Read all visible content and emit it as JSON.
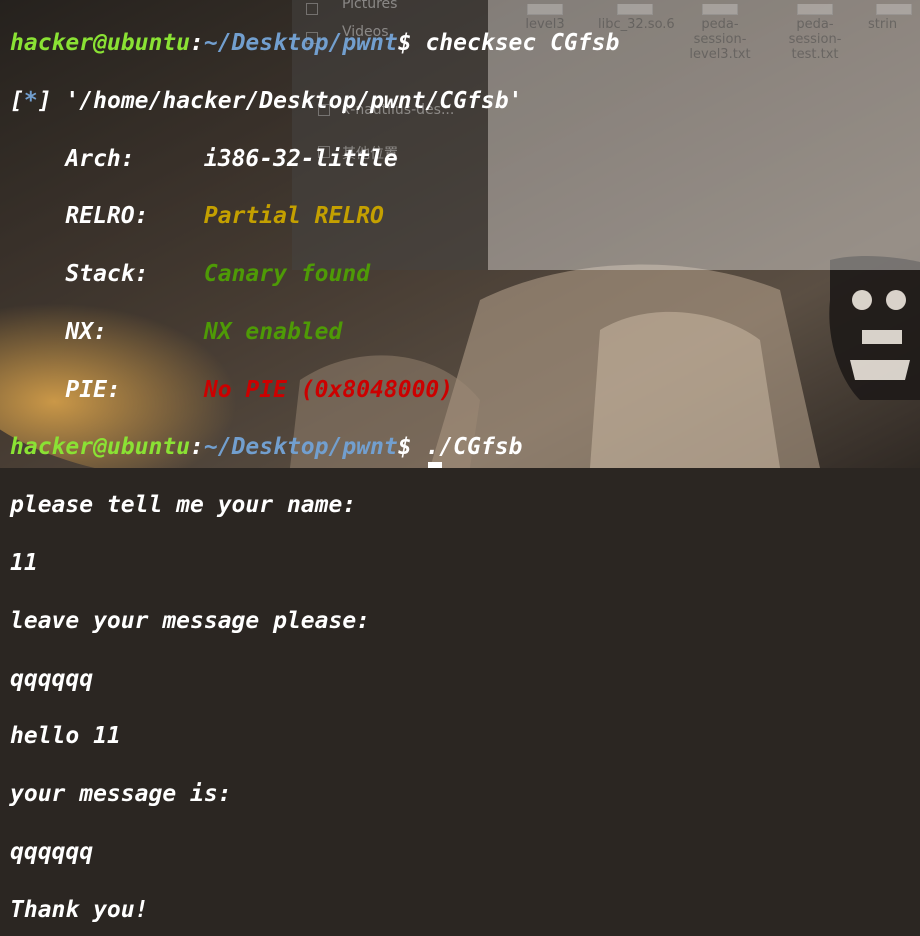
{
  "file_manager": {
    "sidebar": [
      "Pictures",
      "Videos",
      "x-nautilus-des...",
      "其他位置"
    ],
    "files": [
      "level3",
      "libc_32.so.6",
      "peda-session-level3.txt",
      "peda-session-test.txt",
      "strin"
    ]
  },
  "terminal": {
    "prompt1": {
      "user": "hacker@ubuntu",
      "colon": ":",
      "path": "~/Desktop/pwnt",
      "dollar": "$ ",
      "command": "checksec CGfsb"
    },
    "checksec": {
      "bracket_open": "[",
      "star": "*",
      "bracket_close": "]",
      "file": " '/home/hacker/Desktop/pwnt/CGfsb'",
      "arch_label": "    Arch:     ",
      "arch_value": "i386-32-little",
      "relro_label": "    RELRO:    ",
      "relro_value": "Partial RELRO",
      "stack_label": "    Stack:    ",
      "stack_value": "Canary found",
      "nx_label": "    NX:       ",
      "nx_value": "NX enabled",
      "pie_label": "    PIE:      ",
      "pie_value": "No PIE (0x8048000)"
    },
    "prompt2": {
      "user": "hacker@ubuntu",
      "colon": ":",
      "path": "~/Desktop/pwnt",
      "dollar": "$ ",
      "command": "./CGfsb"
    },
    "output": [
      "please tell me your name:",
      "11",
      "leave your message please:",
      "qqqqqq",
      "hello 11",
      "your message is:",
      "qqqqqq",
      "Thank you!"
    ]
  }
}
